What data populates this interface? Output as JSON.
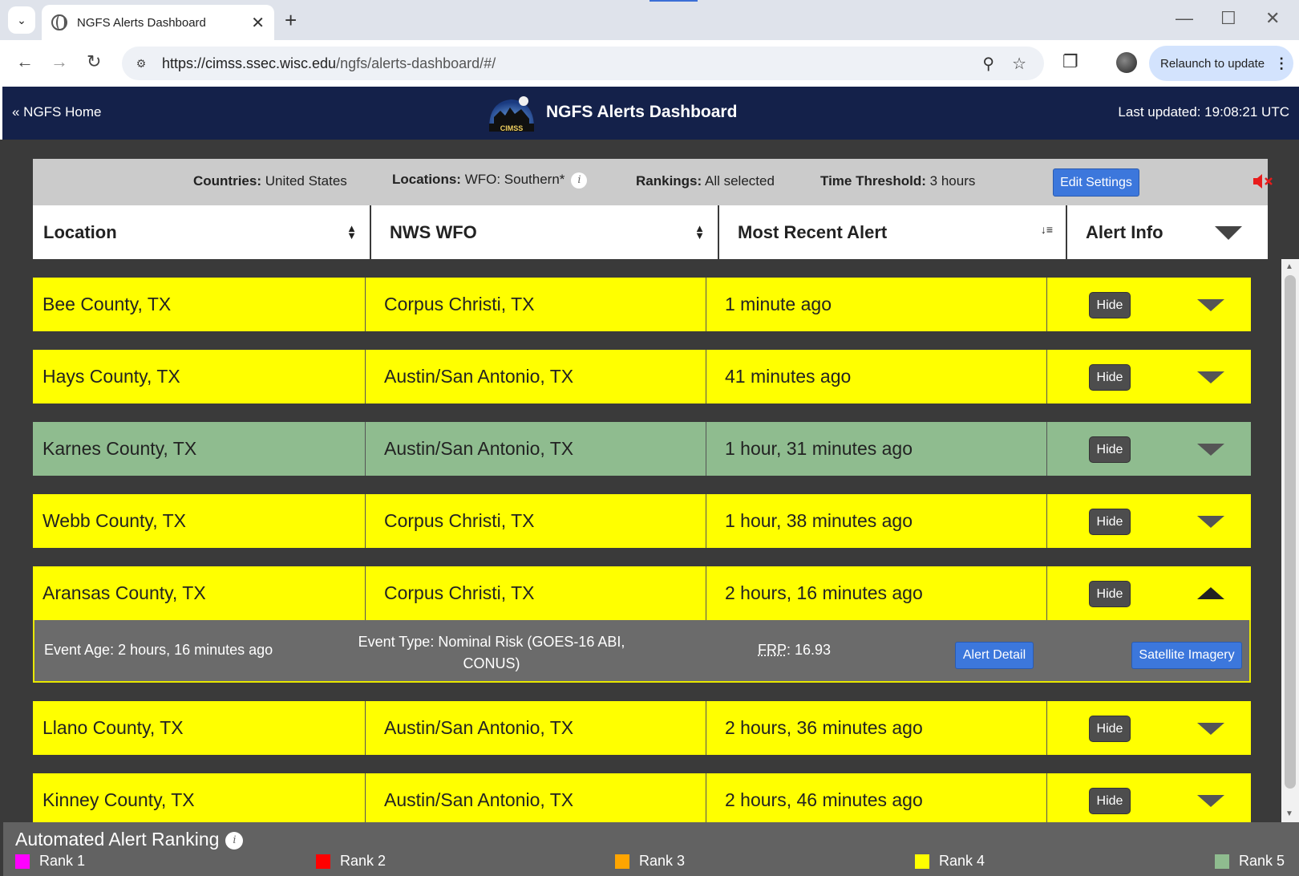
{
  "browser": {
    "tab_title": "NGFS Alerts Dashboard",
    "url_host": "https://cimss.ssec.wisc.edu",
    "url_path": "/ngfs/alerts-dashboard/#/",
    "relaunch_label": "Relaunch to update"
  },
  "header": {
    "home_link": "« NGFS Home",
    "logo_text": "CIMSS",
    "title": "NGFS Alerts Dashboard",
    "last_updated": "Last updated: 19:08:21 UTC"
  },
  "settings": {
    "countries_label": "Countries:",
    "countries_value": "United States",
    "locations_label": "Locations:",
    "locations_value": "WFO: Southern*",
    "rankings_label": "Rankings:",
    "rankings_value": "All selected",
    "threshold_label": "Time Threshold:",
    "threshold_value": "3 hours",
    "edit_button": "Edit Settings"
  },
  "table": {
    "headers": [
      "Location",
      "NWS WFO",
      "Most Recent Alert",
      "Alert Info"
    ],
    "hide_label": "Hide",
    "rows": [
      {
        "location": "Bee County, TX",
        "wfo": "Corpus Christi, TX",
        "alert": "1 minute ago",
        "rank": 4
      },
      {
        "location": "Hays County, TX",
        "wfo": "Austin/San Antonio, TX",
        "alert": "41 minutes ago",
        "rank": 4
      },
      {
        "location": "Karnes County, TX",
        "wfo": "Austin/San Antonio, TX",
        "alert": "1 hour, 31 minutes ago",
        "rank": 5
      },
      {
        "location": "Webb County, TX",
        "wfo": "Corpus Christi, TX",
        "alert": "1 hour, 38 minutes ago",
        "rank": 4
      },
      {
        "location": "Aransas County, TX",
        "wfo": "Corpus Christi, TX",
        "alert": "2 hours, 16 minutes ago",
        "rank": 4,
        "expanded": true
      },
      {
        "location": "Llano County, TX",
        "wfo": "Austin/San Antonio, TX",
        "alert": "2 hours, 36 minutes ago",
        "rank": 4
      },
      {
        "location": "Kinney County, TX",
        "wfo": "Austin/San Antonio, TX",
        "alert": "2 hours, 46 minutes ago",
        "rank": 4
      }
    ],
    "detail": {
      "event_age": "Event Age: 2 hours, 16 minutes ago",
      "event_type": "Event Type: Nominal Risk (GOES-16 ABI, CONUS)",
      "frp_abbr": "FRP",
      "frp_value": ": 16.93",
      "alert_detail_button": "Alert Detail",
      "satellite_button": "Satellite Imagery"
    }
  },
  "legend": {
    "title": "Automated Alert Ranking",
    "items": [
      {
        "label": "Rank 1",
        "color": "#ff00ff"
      },
      {
        "label": "Rank 2",
        "color": "#ff0000"
      },
      {
        "label": "Rank 3",
        "color": "#ffa500"
      },
      {
        "label": "Rank 4",
        "color": "#ffff00"
      },
      {
        "label": "Rank 5",
        "color": "#8fbc8f"
      }
    ]
  }
}
